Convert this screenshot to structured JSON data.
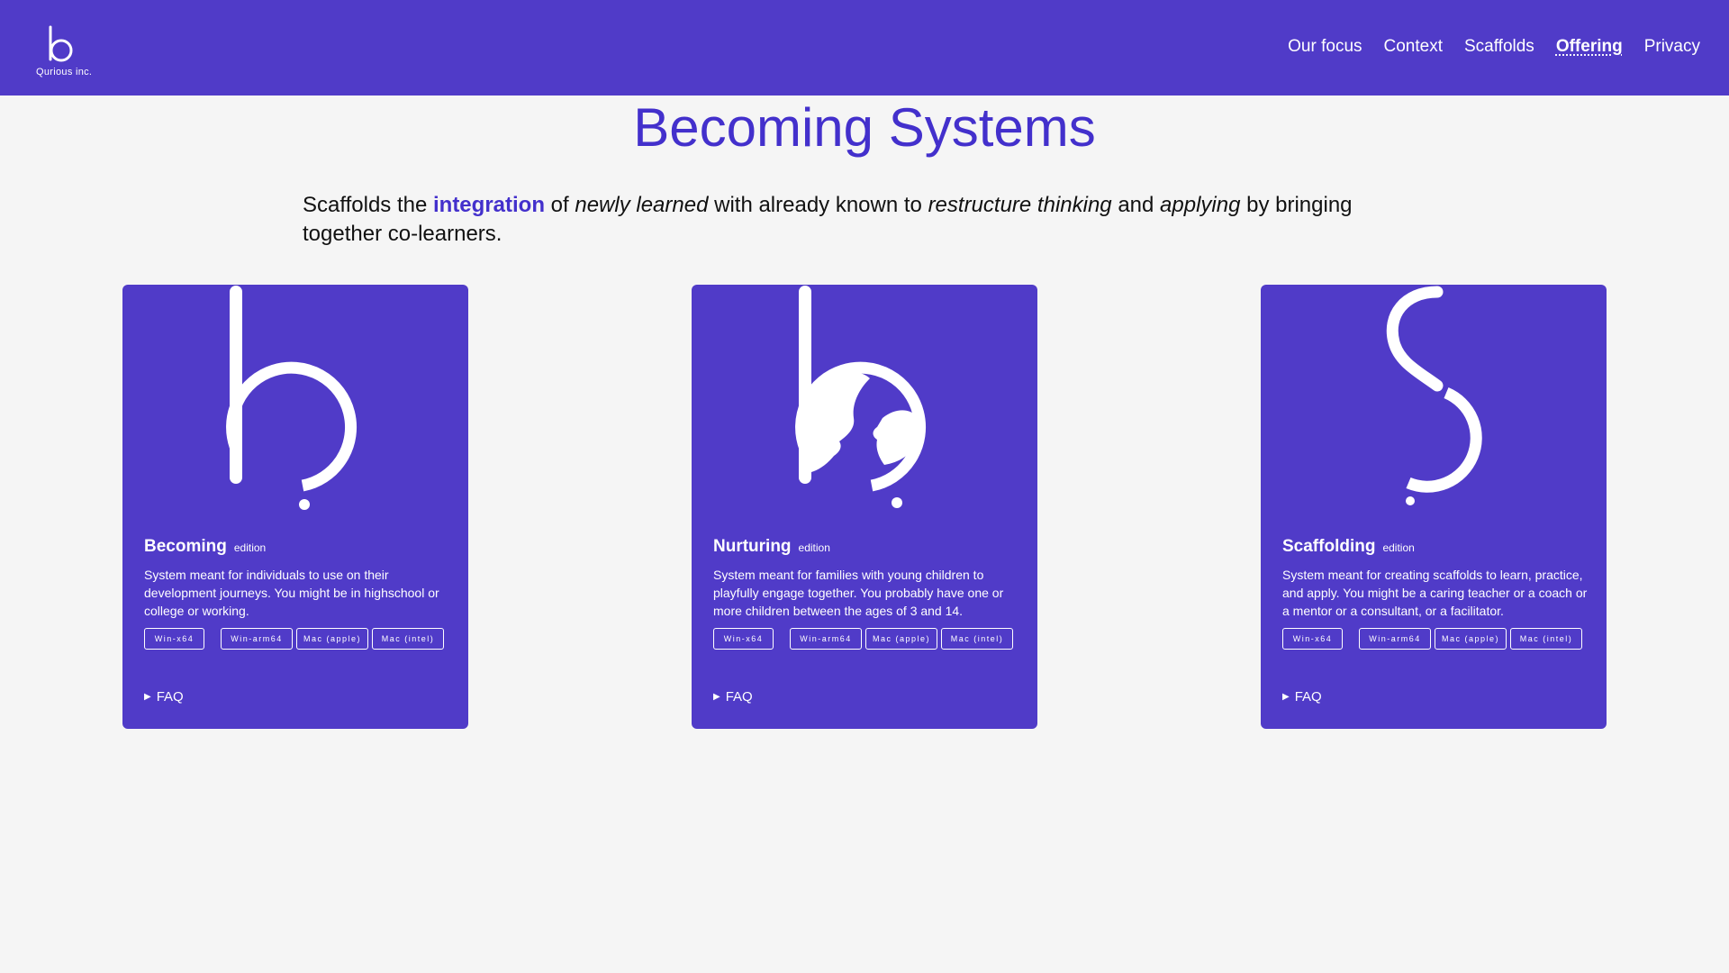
{
  "header": {
    "logo_text": "Qurious inc.",
    "nav": [
      {
        "label": "Our focus"
      },
      {
        "label": "Context"
      },
      {
        "label": "Scaffolds"
      },
      {
        "label": "Offering"
      },
      {
        "label": "Privacy"
      }
    ],
    "active_nav": "Offering"
  },
  "main": {
    "title": "Becoming Systems",
    "intro": {
      "p1": "Scaffolds the ",
      "highlight": "integration",
      "p2": " of ",
      "em1": "newly learned",
      "p3": " with already known to ",
      "em2": "restructure thinking",
      "p4": " and ",
      "em3": "applying",
      "p5": " by bringing together co-learners."
    },
    "cards": [
      {
        "name": "Becoming",
        "edition": "edition",
        "description": "System meant for individuals to use on their development journeys. You might be in highschool or college or working.",
        "downloads": [
          "Win-x64",
          "Win-arm64",
          "Mac (apple)",
          "Mac (intel)"
        ],
        "faq": "FAQ"
      },
      {
        "name": "Nurturing",
        "edition": "edition",
        "description": "System meant for families with young children to playfully engage together. You probably have one or more children between the ages of 3 and 14.",
        "downloads": [
          "Win-x64",
          "Win-arm64",
          "Mac (apple)",
          "Mac (intel)"
        ],
        "faq": "FAQ"
      },
      {
        "name": "Scaffolding",
        "edition": "edition",
        "description": "System meant for creating scaffolds to learn, practice, and apply. You might be a caring teacher or a coach or a mentor or a consultant, or a facilitator.",
        "downloads": [
          "Win-x64",
          "Win-arm64",
          "Mac (apple)",
          "Mac (intel)"
        ],
        "faq": "FAQ"
      }
    ]
  },
  "colors": {
    "brand": "#503bc8",
    "title": "#4330cc",
    "background": "#f5f5f5"
  }
}
